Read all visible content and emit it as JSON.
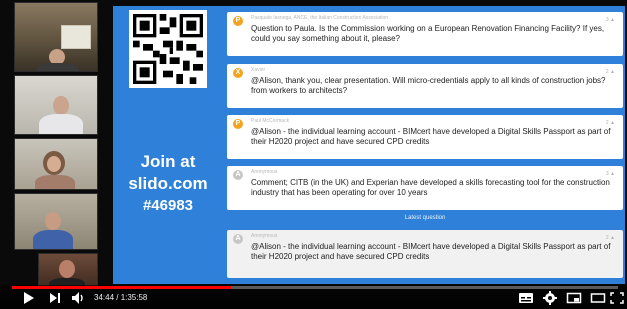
{
  "slido": {
    "join_line1": "Join at",
    "join_line2": "slido.com",
    "join_line3": "#46983",
    "latest_label": "Latest question",
    "questions": [
      {
        "author": "Pasquale Iasnega, ANCE, the Italian Construction Association",
        "avatar_letter": "P",
        "avatar_color": "#f4a321",
        "likes": "3 ▲",
        "text": "Question to Paula. Is the Commission working on a European Renovation Financing Facility? If yes, could you say something about it, please?"
      },
      {
        "author": "Xavier",
        "avatar_letter": "X",
        "avatar_color": "#f4a321",
        "likes": "2 ▲",
        "text": "@Alison, thank you, clear presentation. Will micro-credentials apply to all kinds of construction jobs? from workers to architects?"
      },
      {
        "author": "Paul McCormack",
        "avatar_letter": "P",
        "avatar_color": "#f4a321",
        "likes": "2 ▲",
        "text": "@Alison - the individual learning account - BIMcert have developed a Digital Skills Passport as part of their H2020 project and have secured CPD credits"
      },
      {
        "author": "Anonymous",
        "avatar_letter": "A",
        "avatar_color": "#c7c7c7",
        "likes": "3 ▲",
        "text": "Comment; CITB (in the UK) and Experian have developed a skills forecasting tool for the construction industry that has been operating for over 10 years"
      },
      {
        "author": "Anonymous",
        "avatar_letter": "A",
        "avatar_color": "#c7c7c7",
        "likes": "2 ▲",
        "text": "@Alison - the individual learning account - BIMcert have developed a Digital Skills Passport as part of their H2020 project and have secured CPD credits"
      }
    ]
  },
  "player": {
    "time": "34:44 / 1:35:58",
    "progress_fraction": 0.362,
    "icons": [
      "play-icon",
      "next-icon",
      "volume-icon",
      "subtitles-icon",
      "settings-icon",
      "miniplayer-icon",
      "theater-icon",
      "fullscreen-icon"
    ]
  },
  "colors": {
    "slido_blue": "#2e80d8",
    "progress_red": "#ff0000"
  }
}
